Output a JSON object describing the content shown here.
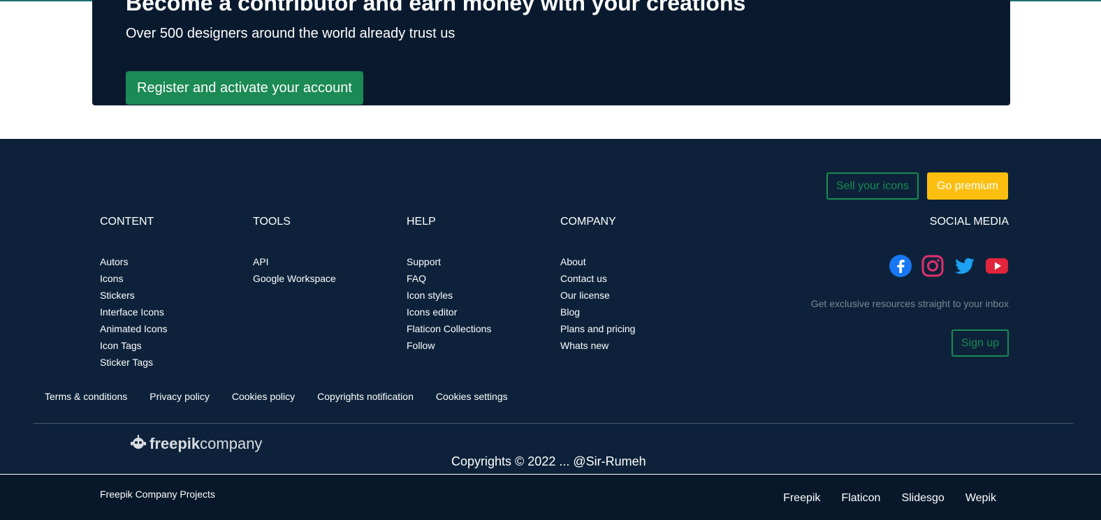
{
  "banner": {
    "title": "Become a contributor and earn money with your creations",
    "subtitle": "Over 500 designers around the world already trust us",
    "register_label": "Register and activate your account"
  },
  "footer": {
    "sell_label": "Sell your icons",
    "premium_label": "Go premium",
    "columns": [
      {
        "title": "CONTENT",
        "items": [
          "Autors",
          "Icons",
          "Stickers",
          "Interface Icons",
          "Animated Icons",
          "Icon Tags",
          "Sticker Tags"
        ]
      },
      {
        "title": "TOOLS",
        "items": [
          "API",
          "Google Workspace"
        ]
      },
      {
        "title": "HELP",
        "items": [
          "Support",
          "FAQ",
          "Icon styles",
          "Icons editor",
          "Flaticon Collections",
          "Follow"
        ]
      },
      {
        "title": "COMPANY",
        "items": [
          "About",
          "Contact us",
          "Our license",
          "Blog",
          "Plans and pricing",
          "Whats new"
        ]
      }
    ],
    "social_title": "SOCIAL MEDIA",
    "social_icons": [
      "facebook-icon",
      "instagram-icon",
      "twitter-icon",
      "youtube-icon"
    ],
    "newsletter_text": "Get exclusive resources straight to your inbox",
    "signup_label": "Sign up",
    "legal_links": [
      "Terms & conditions",
      "Privacy policy",
      "Cookies policy",
      "Copyrights notification",
      "Cookies settings"
    ],
    "brand_strong": "freepik",
    "brand_light": "company",
    "copyright": "Copyrights © 2022 ... @Sir-Rumeh"
  },
  "bottom": {
    "projects_label": "Freepik Company Projects",
    "links": [
      "Freepik",
      "Flaticon",
      "Slidesgo",
      "Wepik"
    ]
  },
  "colors": {
    "accent_green": "#1b8a54",
    "premium_yellow": "#fcbf0f",
    "footer_bg": "#0d223a",
    "banner_bg": "#0a1a2e"
  }
}
